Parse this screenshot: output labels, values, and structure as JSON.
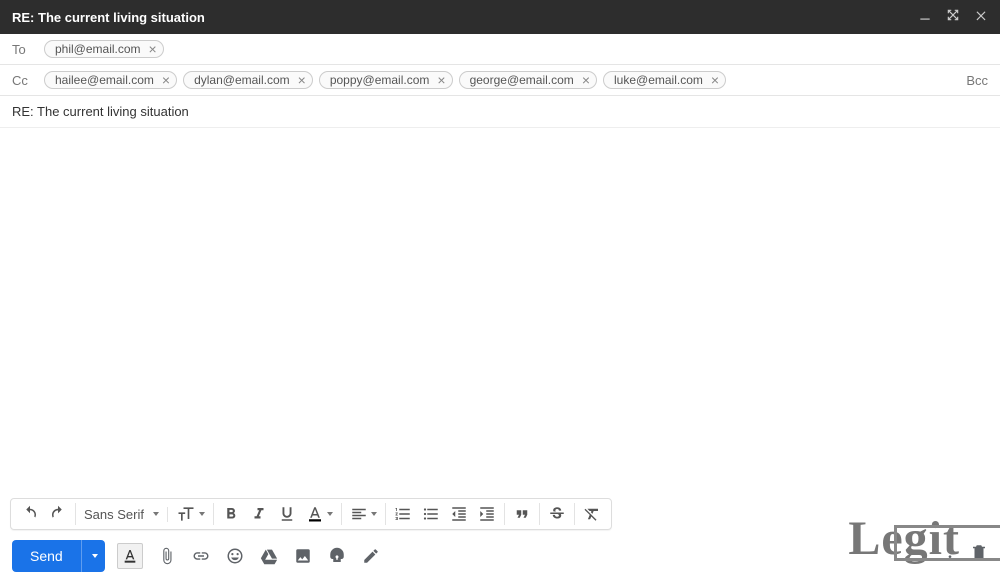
{
  "header": {
    "title": "RE: The current living situation"
  },
  "to": {
    "label": "To",
    "chips": [
      "phil@email.com"
    ]
  },
  "cc": {
    "label": "Cc",
    "chips": [
      "hailee@email.com",
      "dylan@email.com",
      "poppy@email.com",
      "george@email.com",
      "luke@email.com"
    ],
    "bcc_label": "Bcc"
  },
  "subject": "RE: The current living situation",
  "body": "",
  "toolbar": {
    "font_family": "Sans Serif"
  },
  "send": {
    "label": "Send"
  },
  "watermark": "Legit"
}
